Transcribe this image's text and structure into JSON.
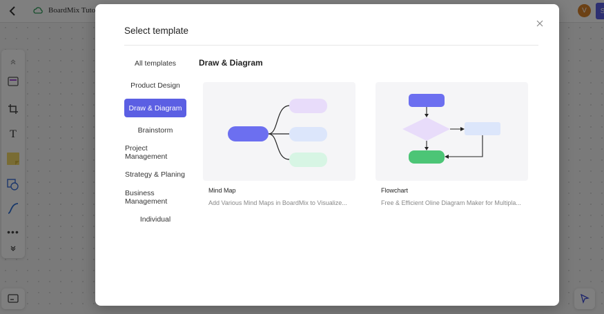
{
  "app": {
    "doc_title": "BoardMix Tutor",
    "avatar_initial": "V",
    "share_label": "S"
  },
  "modal": {
    "title": "Select template",
    "close_label": "×",
    "categories": [
      {
        "label": "All templates"
      },
      {
        "label": "Product Design"
      },
      {
        "label": "Draw & Diagram",
        "active": true
      },
      {
        "label": "Brainstorm"
      },
      {
        "label": "Project Management"
      },
      {
        "label": "Strategy & Planing"
      },
      {
        "label": "Business Management"
      },
      {
        "label": "Individual"
      }
    ],
    "section_title": "Draw & Diagram",
    "templates": [
      {
        "name": "Mind Map",
        "description": "Add Various Mind Maps in BoardMix to Visualize..."
      },
      {
        "name": "Flowchart",
        "description": "Free & Efficient Oline Diagram Maker for Multipla..."
      }
    ]
  },
  "colors": {
    "accent": "#5b5fe3",
    "node_purple": "#6c6ff0",
    "node_lavender": "#e8dcfa",
    "node_blue": "#dce6fb",
    "node_green": "#d7f5e4",
    "node_green_solid": "#4cc576"
  }
}
